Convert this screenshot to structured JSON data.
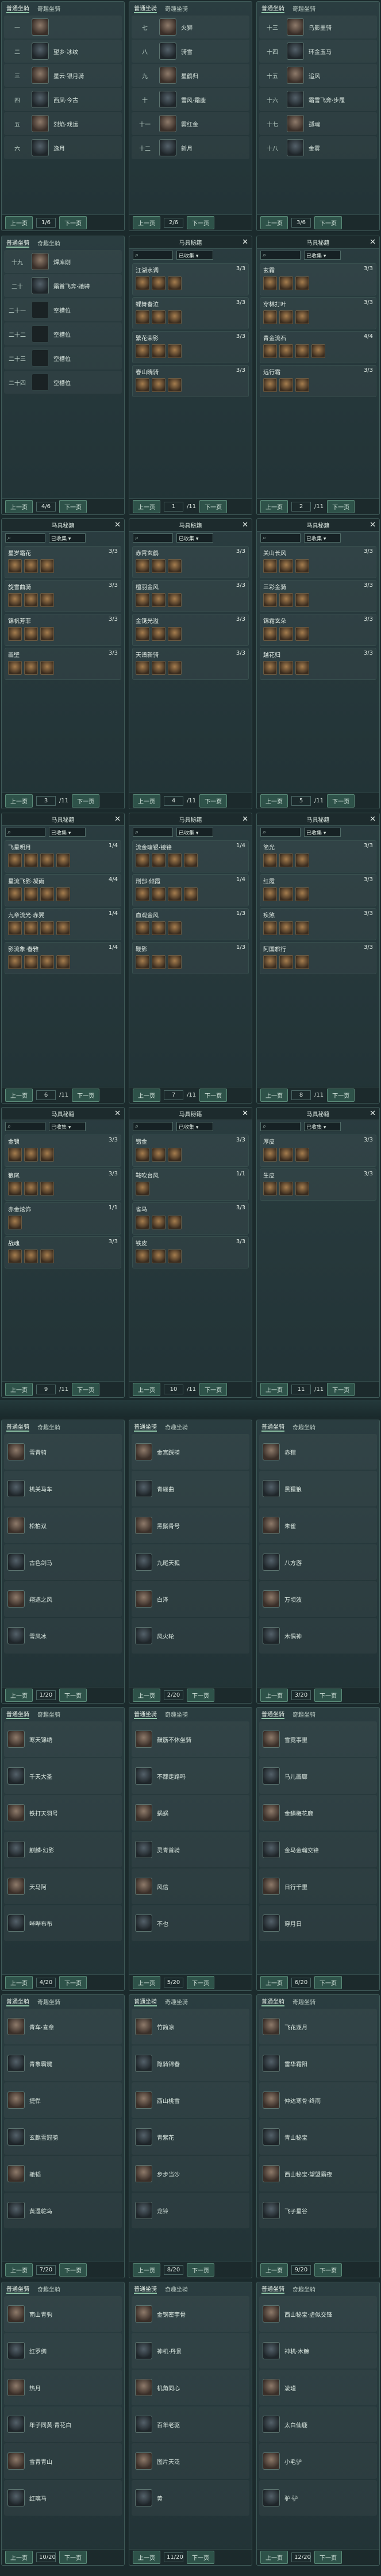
{
  "tabs": {
    "common": "普通坐骑",
    "rare": "奇趣坐骑"
  },
  "pager": {
    "prev": "上一页",
    "next": "下一页"
  },
  "set_panel": {
    "title": "马具秘籍",
    "filter": "已收集",
    "close": "✕"
  },
  "grid1": [
    {
      "page": "1/6",
      "rows": [
        {
          "num": "一",
          "name": ""
        },
        {
          "num": "二",
          "name": "望乡·冰纹"
        },
        {
          "num": "三",
          "name": "星云·银月骑"
        },
        {
          "num": "四",
          "name": "西凤·今古"
        },
        {
          "num": "五",
          "name": "烈焰·戏运"
        },
        {
          "num": "六",
          "name": "逸月"
        }
      ]
    },
    {
      "page": "2/6",
      "rows": [
        {
          "num": "七",
          "name": "火狮"
        },
        {
          "num": "八",
          "name": "骑雪"
        },
        {
          "num": "九",
          "name": "星鹤归"
        },
        {
          "num": "十",
          "name": "雪风·霜鹿"
        },
        {
          "num": "十一",
          "name": "霸红金"
        },
        {
          "num": "十二",
          "name": "新月"
        }
      ]
    },
    {
      "page": "3/6",
      "rows": [
        {
          "num": "十三",
          "name": "乌影墨骑"
        },
        {
          "num": "十四",
          "name": "环金玉马"
        },
        {
          "num": "十五",
          "name": "追风"
        },
        {
          "num": "十六",
          "name": "霜雪飞奔·步履"
        },
        {
          "num": "十七",
          "name": "孤魂"
        },
        {
          "num": "十八",
          "name": "金雾"
        }
      ]
    }
  ],
  "grid2_left": {
    "page": "4/6",
    "rows": [
      {
        "num": "十九",
        "name": "焊库刚"
      },
      {
        "num": "二十",
        "name": "霜首飞奔·驰骋"
      },
      {
        "num": "二十一",
        "name": "空槽位"
      },
      {
        "num": "二十二",
        "name": "空槽位"
      },
      {
        "num": "二十三",
        "name": "空槽位"
      },
      {
        "num": "二十四",
        "name": "空槽位"
      }
    ]
  },
  "set_pages": [
    {
      "page": "1",
      "total": "/11",
      "sets": [
        {
          "name": "江湖水调",
          "count": "3/3"
        },
        {
          "name": "蝶舞春泣",
          "count": "3/3"
        },
        {
          "name": "繁花荣影",
          "count": "3/3"
        },
        {
          "name": "春山晓骑",
          "count": "3/3"
        }
      ]
    },
    {
      "page": "2",
      "total": "/11",
      "sets": [
        {
          "name": "玄霜",
          "count": "3/3"
        },
        {
          "name": "穿林打叶",
          "count": "3/3"
        },
        {
          "name": "青金流石",
          "count": "4/4"
        },
        {
          "name": "远行霜",
          "count": "3/3"
        }
      ]
    },
    {
      "page": "3",
      "total": "/11",
      "sets": [
        {
          "name": "星岁霜花",
          "count": "3/3"
        },
        {
          "name": "旋雪曲骑",
          "count": "3/3"
        },
        {
          "name": "锦帆芳菲",
          "count": "3/3"
        },
        {
          "name": "画壁",
          "count": "3/3"
        }
      ]
    },
    {
      "page": "4",
      "total": "/11",
      "sets": [
        {
          "name": "赤霄玄鹤",
          "count": "3/3"
        },
        {
          "name": "檀羽金风",
          "count": "3/3"
        },
        {
          "name": "金镌光溢",
          "count": "3/3"
        },
        {
          "name": "天谱新骑",
          "count": "3/3"
        }
      ]
    },
    {
      "page": "5",
      "total": "/11",
      "sets": [
        {
          "name": "关山长风",
          "count": "3/3"
        },
        {
          "name": "三彩金骑",
          "count": "3/3"
        },
        {
          "name": "锦霜玄朵",
          "count": "3/3"
        },
        {
          "name": "越花归",
          "count": "3/3"
        }
      ]
    },
    {
      "page": "6",
      "total": "/11",
      "sets": [
        {
          "name": "飞星明月",
          "count": "1/4"
        },
        {
          "name": "星流飞影·凝雨",
          "count": "4/4"
        },
        {
          "name": "九章流光·赤翼",
          "count": "1/4"
        },
        {
          "name": "影流象·春雅",
          "count": "1/4"
        }
      ]
    },
    {
      "page": "7",
      "total": "/11",
      "sets": [
        {
          "name": "流金暗银·镜锋",
          "count": "1/4"
        },
        {
          "name": "刑部·倾霞",
          "count": "1/4"
        },
        {
          "name": "血观金风",
          "count": "1/3"
        },
        {
          "name": "鞭影",
          "count": "1/3"
        }
      ]
    },
    {
      "page": "8",
      "total": "/11",
      "sets": [
        {
          "name": "简光",
          "count": "3/3"
        },
        {
          "name": "红霞",
          "count": "3/3"
        },
        {
          "name": "疾煞",
          "count": "3/3"
        },
        {
          "name": "阿国旅行",
          "count": "3/3"
        }
      ]
    },
    {
      "page": "9",
      "total": "/11",
      "sets": [
        {
          "name": "金锁",
          "count": "3/3"
        },
        {
          "name": "狼尾",
          "count": "3/3"
        },
        {
          "name": "赤金炫饰",
          "count": "1/1"
        },
        {
          "name": "战魂",
          "count": "3/3"
        }
      ]
    },
    {
      "page": "10",
      "total": "/11",
      "sets": [
        {
          "name": "错金",
          "count": "3/3"
        },
        {
          "name": "鞍吹台风",
          "count": "1/1"
        },
        {
          "name": "雀马",
          "count": "3/3"
        },
        {
          "name": "铁皮",
          "count": "3/3"
        }
      ]
    },
    {
      "page": "11",
      "total": "/11",
      "sets": [
        {
          "name": "厚皮",
          "count": "3/3"
        },
        {
          "name": "生皮",
          "count": "3/3"
        }
      ]
    }
  ],
  "rare_pages": [
    {
      "page": "1/20",
      "rows": [
        "雪青骑",
        "机关马车",
        "松柏双",
        "古色剑马",
        "翔逐之风",
        "雪风冰"
      ]
    },
    {
      "page": "2/20",
      "rows": [
        "金宫踩骑",
        "青骊曲",
        "黑鬃骨号",
        "九尾天狐",
        "白泽",
        "风火轮"
      ]
    },
    {
      "page": "3/20",
      "rows": [
        "赤狸",
        "黑猩狼",
        "朱雀",
        "八方游",
        "万顷波",
        "木偶神"
      ]
    },
    {
      "page": "4/20",
      "rows": [
        "寒天锦绣",
        "千天大圣",
        "铁打天羽号",
        "麒麟·幻影",
        "天马阿",
        "哔哔布布"
      ]
    },
    {
      "page": "5/20",
      "rows": [
        "鼓筋不休坐骑",
        "不都走路吗",
        "蜗蜗",
        "灵青首骑",
        "风信",
        "不也"
      ]
    },
    {
      "page": "6/20",
      "rows": [
        "雪霓事里",
        "马儿画廊",
        "金鳞梅花鹿",
        "金马金翰交锋",
        "日行千里",
        "穿月日"
      ]
    },
    {
      "page": "7/20",
      "rows": [
        "青车·喜章",
        "青象霸鍵",
        "捷悍",
        "玄麒雪冠骑",
        "驰韬",
        "黄湿鸵鸟"
      ]
    },
    {
      "page": "8/20",
      "rows": [
        "竹简凉",
        "隐骑锦春",
        "西山桃雪",
        "青紫花",
        "步步当沙",
        "龙铃"
      ]
    },
    {
      "page": "9/20",
      "rows": [
        "飞花逐月",
        "雷华霜阳",
        "仲达寒骨·终雨",
        "青山秘宝",
        "西山秘宝·望盟霜夜",
        "飞子星谷"
      ]
    },
    {
      "page": "10/20",
      "rows": [
        "南山青驹",
        "红罗绸",
        "热月",
        "年子同黄·青花白",
        "雪青青山",
        "红璃马"
      ]
    },
    {
      "page": "11/20",
      "rows": [
        "金钢密宇骨",
        "神机·丹景",
        "机角同心",
        "百年老驱",
        "图片天泛",
        "黄"
      ]
    },
    {
      "page": "12/20",
      "rows": [
        "西山秘宝·虚似交锋",
        "神机·木鲸",
        "凌瑾",
        "太白仙鹿",
        "小毛驴",
        "驴·驴"
      ]
    }
  ]
}
